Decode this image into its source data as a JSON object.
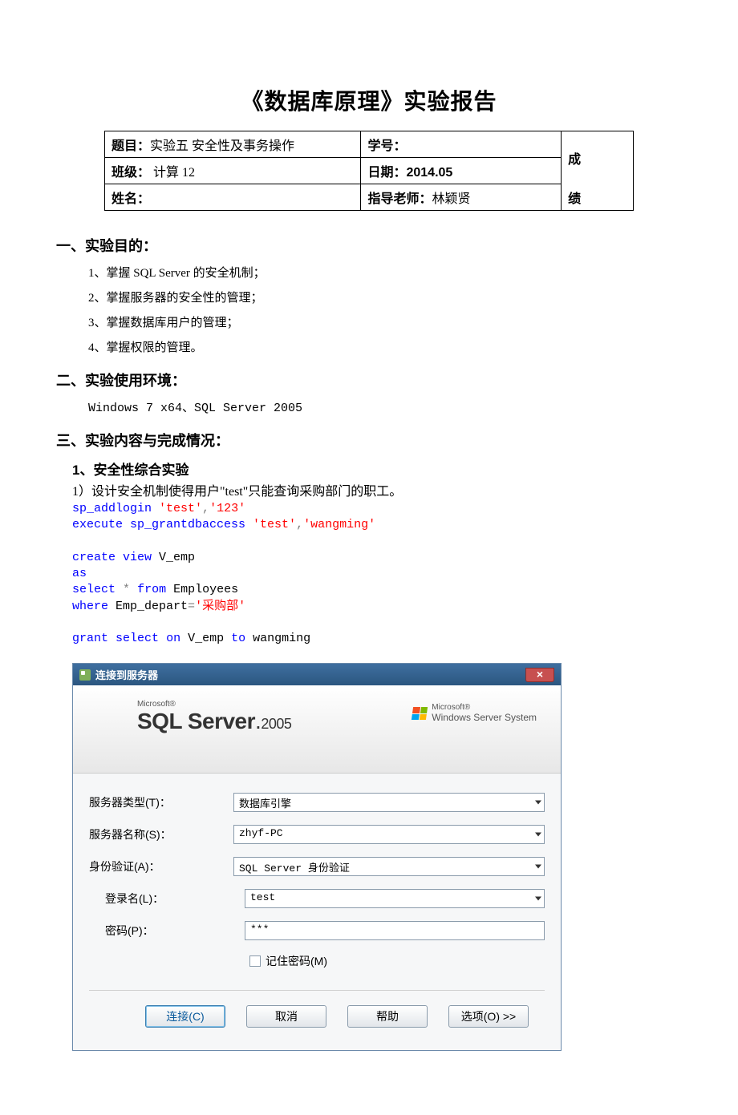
{
  "doc_title": "《数据库原理》实验报告",
  "info": {
    "topic_label": "题目：",
    "topic_value": "实验五 安全性及事务操作",
    "sid_label": "学号：",
    "sid_value": "",
    "class_label": "班级：",
    "class_value": "计算 12",
    "date_label": "日期：",
    "date_value": "2014.05",
    "name_label": "姓名：",
    "name_value": "",
    "teacher_label": "指导老师：",
    "teacher_value": "林颖贤",
    "grade_top": "成",
    "grade_bottom": "绩"
  },
  "section1": {
    "head": "一、实验目的：",
    "items": [
      "1、掌握 SQL Server 的安全机制；",
      "2、掌握服务器的安全性的管理；",
      "3、掌握数据库用户的管理；",
      "4、掌握权限的管理。"
    ]
  },
  "section2": {
    "head": "二、实验使用环境：",
    "env": "Windows 7 x64、SQL Server 2005"
  },
  "section3": {
    "head": "三、实验内容与完成情况：",
    "sub": "1、安全性综合实验",
    "task": "1）设计安全机制使得用户\"test\"只能查询采购部门的职工。",
    "code_tokens": [
      {
        "t": "sp_addlogin ",
        "c": "kw"
      },
      {
        "t": "'test'",
        "c": "str"
      },
      {
        "t": ",",
        "c": "op"
      },
      {
        "t": "'123'",
        "c": "str"
      },
      {
        "t": "\n",
        "c": ""
      },
      {
        "t": "execute",
        "c": "kw"
      },
      {
        "t": " sp_grantdbaccess ",
        "c": "kw"
      },
      {
        "t": "'test'",
        "c": "str"
      },
      {
        "t": ",",
        "c": "op"
      },
      {
        "t": "'wangming'",
        "c": "str"
      },
      {
        "t": "\n\n",
        "c": ""
      },
      {
        "t": "create",
        "c": "kw"
      },
      {
        "t": " ",
        "c": ""
      },
      {
        "t": "view",
        "c": "kw"
      },
      {
        "t": " V_emp\n",
        "c": ""
      },
      {
        "t": "as",
        "c": "kw"
      },
      {
        "t": "\n",
        "c": ""
      },
      {
        "t": "select",
        "c": "kw"
      },
      {
        "t": " ",
        "c": ""
      },
      {
        "t": "*",
        "c": "grey"
      },
      {
        "t": " ",
        "c": ""
      },
      {
        "t": "from",
        "c": "kw"
      },
      {
        "t": " Employees\n",
        "c": ""
      },
      {
        "t": "where",
        "c": "kw"
      },
      {
        "t": " Emp_depart",
        "c": ""
      },
      {
        "t": "=",
        "c": "grey"
      },
      {
        "t": "'采购部'",
        "c": "str"
      },
      {
        "t": "\n\n",
        "c": ""
      },
      {
        "t": "grant",
        "c": "kw"
      },
      {
        "t": " ",
        "c": ""
      },
      {
        "t": "select",
        "c": "kw"
      },
      {
        "t": " ",
        "c": ""
      },
      {
        "t": "on",
        "c": "kw"
      },
      {
        "t": " V_emp ",
        "c": ""
      },
      {
        "t": "to",
        "c": "kw"
      },
      {
        "t": " wangming",
        "c": ""
      }
    ]
  },
  "dialog": {
    "title": "连接到服务器",
    "close_x": "×",
    "banner_ms": "Microsoft®",
    "banner_sql_bold": "SQL Server",
    "banner_sql_year": "2005",
    "wss_ms": "Microsoft®",
    "wss_text": "Windows Server System",
    "rows": {
      "server_type_label": "服务器类型(T)：",
      "server_type_value": "数据库引擎",
      "server_name_label": "服务器名称(S)：",
      "server_name_value": "zhyf-PC",
      "auth_label": "身份验证(A)：",
      "auth_value": "SQL Server 身份验证",
      "login_label": "登录名(L)：",
      "login_value": "test",
      "pwd_label": "密码(P)：",
      "pwd_value": "***",
      "remember_label": "记住密码(M)"
    },
    "buttons": {
      "connect": "连接(C)",
      "cancel": "取消",
      "help": "帮助",
      "options": "选项(O) >>"
    }
  }
}
